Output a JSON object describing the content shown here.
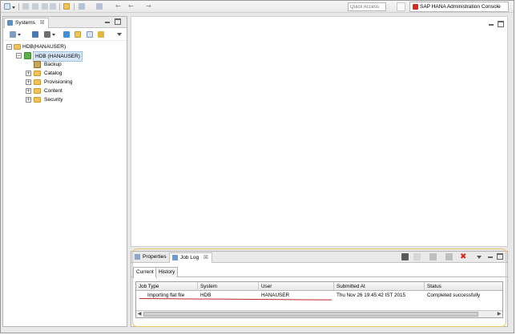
{
  "toolbar": {
    "quick_access_placeholder": "Quick Access",
    "perspective_label": "SAP HANA Administration Console"
  },
  "systems_view": {
    "tab_title": "Systems",
    "close_glyph": "☒",
    "tree": {
      "root": "HDB(HANAUSER)",
      "system": "HDB (HANAUSER)",
      "children": [
        {
          "label": "Backup",
          "expandable": false
        },
        {
          "label": "Catalog",
          "expandable": true
        },
        {
          "label": "Provisioning",
          "expandable": true
        },
        {
          "label": "Content",
          "expandable": true
        },
        {
          "label": "Security",
          "expandable": true
        }
      ],
      "collapse_glyph": "−",
      "expand_glyph": "+"
    }
  },
  "bottom_panel": {
    "tabs": [
      {
        "label": "Properties",
        "active": false
      },
      {
        "label": "Job Log",
        "active": true
      }
    ],
    "close_glyph": "☒",
    "subtabs": [
      {
        "label": "Current",
        "active": true
      },
      {
        "label": "History",
        "active": false
      }
    ],
    "table": {
      "columns": [
        "Job Type",
        "System",
        "User",
        "Submitted At",
        "Status"
      ],
      "rows": [
        [
          "Importing flat file",
          "HDB",
          "HANAUSER",
          "Thu Nov 26 19:45:42 IST 2015",
          "Completed successfully"
        ]
      ]
    }
  },
  "colors": {
    "annotation_box": "#e8c766",
    "annotation_underline": "#c0262d",
    "stop_icon": "#d62b1f"
  }
}
